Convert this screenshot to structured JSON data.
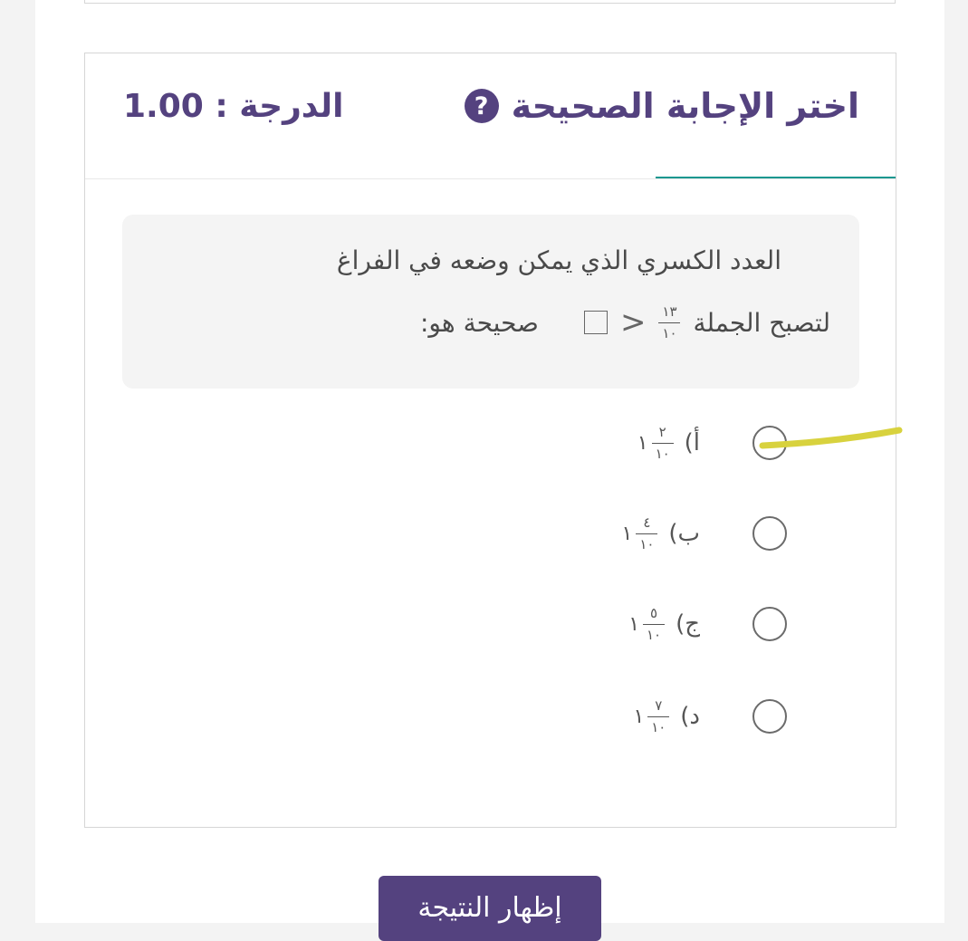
{
  "header": {
    "title": "اختر الإجابة الصحيحة",
    "help_glyph": "?",
    "grade": "الدرجة : 1.00"
  },
  "question": {
    "line1": "العدد الكسري الذي يمكن وضعه في الفراغ",
    "line2_start": "لتصبح الجملة",
    "fraction": {
      "numerator": "١٣",
      "denominator": "١٠"
    },
    "relation": "<",
    "line2_end": "صحيحة هو:"
  },
  "options": [
    {
      "label": "أ)",
      "whole": "١",
      "numerator": "٢",
      "denominator": "١٠",
      "selected": false
    },
    {
      "label": "ب)",
      "whole": "١",
      "numerator": "٤",
      "denominator": "١٠",
      "selected": false
    },
    {
      "label": "ج)",
      "whole": "١",
      "numerator": "٥",
      "denominator": "١٠",
      "selected": false
    },
    {
      "label": "د)",
      "whole": "١",
      "numerator": "٧",
      "denominator": "١٠",
      "selected": false
    }
  ],
  "actions": {
    "show_result": "إظهار النتيجة"
  },
  "colors": {
    "primary": "#54427f",
    "accent": "#17978f",
    "highlight": "#d8d23e"
  }
}
